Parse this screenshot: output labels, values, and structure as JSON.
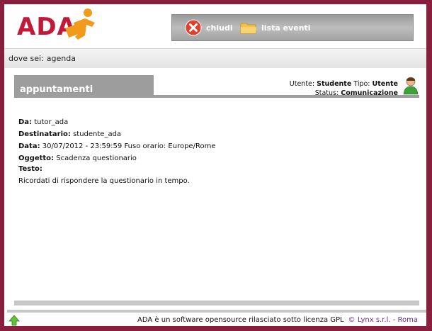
{
  "logo": {
    "text": "ADA"
  },
  "nav": {
    "close_label": "chiudi",
    "events_label": "lista eventi"
  },
  "breadcrumb": {
    "label": "dove sei:",
    "value": "agenda"
  },
  "panel": {
    "title": "appuntamenti"
  },
  "user": {
    "utente_label": "Utente:",
    "utente_value": "Studente",
    "tipo_label": "Tipo:",
    "tipo_value": "Utente",
    "status_label": "Status:",
    "status_value": "Comunicazione"
  },
  "message": {
    "da_label": "Da:",
    "da_value": "tutor_ada",
    "dest_label": "Destinatario:",
    "dest_value": "studente_ada",
    "data_label": "Data:",
    "data_value": "30/07/2012 - 23:59:59 Fuso orario: Europe/Rome",
    "oggetto_label": "Oggetto:",
    "oggetto_value": "Scadenza questionario",
    "testo_label": "Testo:",
    "testo_value": "Ricordati di rispondere la questionario in tempo."
  },
  "footer": {
    "text": "ADA è un software opensource rilasciato sotto licenza GPL",
    "link": "© Lynx s.r.l. - Roma"
  },
  "colors": {
    "frame": "#8a1e3e",
    "logo_red": "#c2183a",
    "logo_orange": "#f29a1a",
    "panel_gray": "#9d9d9d"
  },
  "icons": [
    "ada-logo-figure",
    "close-icon",
    "folder-icon",
    "user-icon",
    "up-arrow-icon"
  ]
}
